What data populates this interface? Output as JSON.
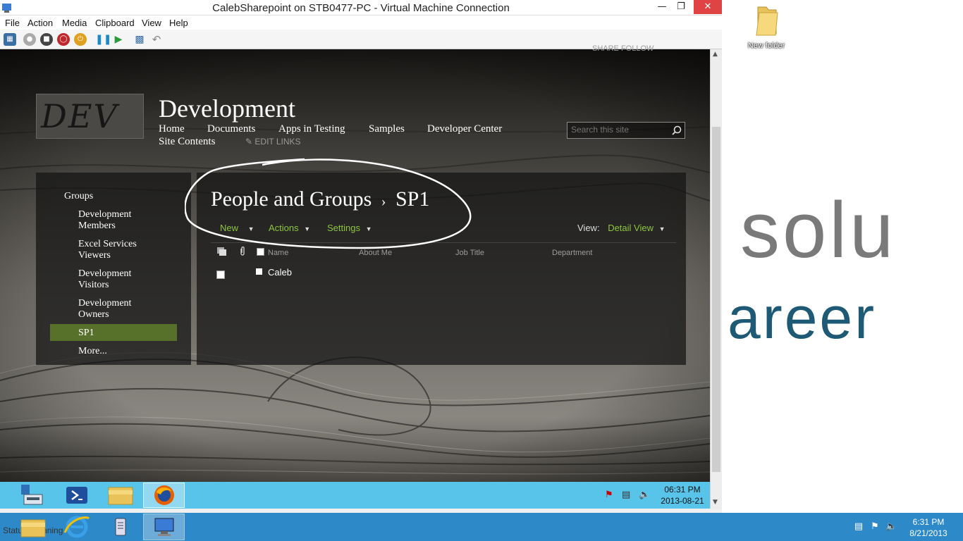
{
  "window": {
    "title": "CalebSharepoint on STB0477-PC - Virtual Machine Connection"
  },
  "menu": [
    "File",
    "Action",
    "Media",
    "Clipboard",
    "View",
    "Help"
  ],
  "site": {
    "logo_text": "DEV",
    "title": "Development",
    "nav": [
      "Home",
      "Documents",
      "Apps in Testing",
      "Samples",
      "Developer Center",
      "Site Contents"
    ],
    "edit_links": "EDIT LINKS",
    "search_placeholder": "Search this site",
    "share_follow": "SHARE   FOLLOW"
  },
  "quick_launch": {
    "heading": "Groups",
    "items": [
      "Development Members",
      "Excel Services Viewers",
      "Development Visitors",
      "Development Owners",
      "SP1",
      "More..."
    ],
    "selected": "SP1"
  },
  "page": {
    "breadcrumb_parent": "People and Groups",
    "breadcrumb_sep": "›",
    "breadcrumb_current": "SP1",
    "commands": [
      "New",
      "Actions",
      "Settings"
    ],
    "view_label": "View:",
    "view_value": "Detail View",
    "columns": [
      "Name",
      "About Me",
      "Job Title",
      "Department"
    ],
    "rows": [
      {
        "name": "Caleb"
      }
    ]
  },
  "guest": {
    "time": "06:31 PM",
    "date": "2013-08-21"
  },
  "host": {
    "status": "Status: Running",
    "time": "6:31 PM",
    "date": "8/21/2013",
    "desktop_folder": "New folder",
    "brand_line1": "solu",
    "brand_line2": "areer"
  },
  "colors": {
    "accent_green": "#8cc63f",
    "selected_bg": "#58712a",
    "guest_taskbar": "#58c4ea",
    "host_taskbar": "#2e89c8"
  }
}
